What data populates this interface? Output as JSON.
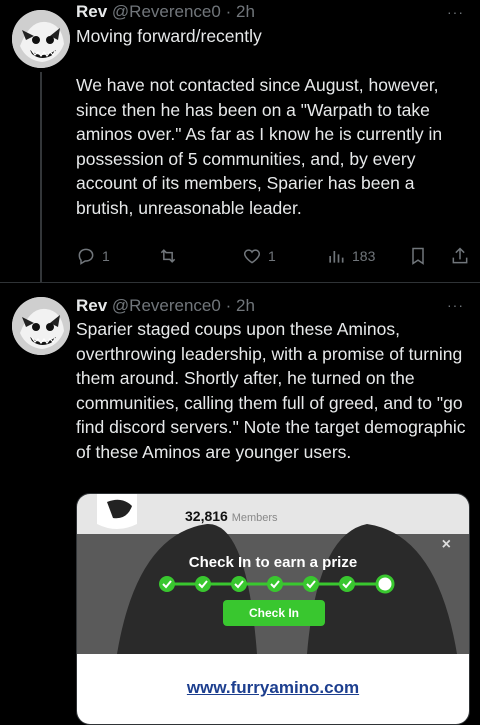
{
  "tweets": [
    {
      "name": "Rev",
      "handle": "@Reverence0",
      "time": "2h",
      "dot": "·",
      "more": "···",
      "text": "Moving forward/recently\n\nWe have not contacted since August, however, since then he has been on a \"Warpath to take aminos over.\" As far as I know he is currently in possession of 5 communities, and, by every account of its members, Sparier has been a brutish, unreasonable leader.",
      "actions": {
        "replies": "1",
        "retweets": "",
        "likes": "1",
        "views": "183"
      }
    },
    {
      "name": "Rev",
      "handle": "@Reverence0",
      "time": "2h",
      "dot": "·",
      "more": "···",
      "text": "Sparier staged coups upon these Aminos, overthrowing leadership, with a promise of turning them around. Shortly after, he turned on the communities, calling them full of greed, and to \"go find discord servers.\" Note the target demographic of these Aminos are younger users."
    }
  ],
  "embed": {
    "members_count": "32,816",
    "members_label": "Members",
    "prize_text": "Check In to earn a prize",
    "checkin_label": "Check In",
    "close": "×",
    "url": "www.furryamino.com"
  },
  "colors": {
    "bg": "#000000",
    "text": "#e7e9ea",
    "muted": "#71767b",
    "green": "#39c72f"
  }
}
